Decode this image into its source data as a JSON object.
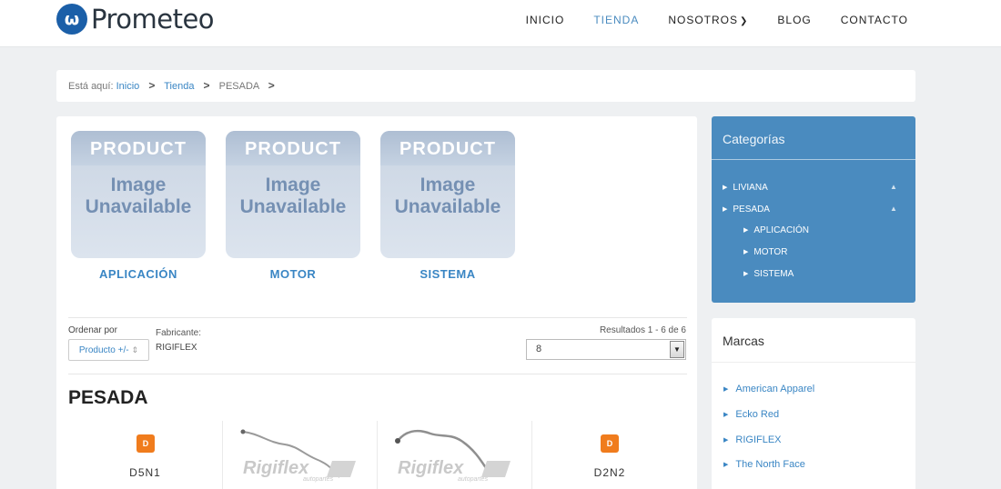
{
  "header": {
    "logo_text": "Prometeo",
    "nav": [
      {
        "label": "INICIO",
        "active": false
      },
      {
        "label": "TIENDA",
        "active": true
      },
      {
        "label": "NOSOTROS",
        "active": false
      },
      {
        "label": "BLOG",
        "active": false
      },
      {
        "label": "CONTACTO",
        "active": false
      }
    ]
  },
  "breadcrumb": {
    "prefix": "Está aquí:",
    "items": [
      "Inicio",
      "Tienda",
      "PESADA"
    ]
  },
  "categories": [
    {
      "image_top": "PRODUCT",
      "image_line1": "Image",
      "image_line2": "Unavailable",
      "label": "APLICACIÓN"
    },
    {
      "image_top": "PRODUCT",
      "image_line1": "Image",
      "image_line2": "Unavailable",
      "label": "MOTOR"
    },
    {
      "image_top": "PRODUCT",
      "image_line1": "Image",
      "image_line2": "Unavailable",
      "label": "SISTEMA"
    }
  ],
  "toolbar": {
    "sort_label": "Ordenar por",
    "sort_value": "Producto +/-",
    "manufacturer_label": "Fabricante:",
    "manufacturer_value": "RIGIFLEX",
    "results": "Resultados 1 - 6 de 6",
    "per_page": "8"
  },
  "section_title": "PESADA",
  "products": [
    {
      "name": "D5N1",
      "image": "brand-badge"
    },
    {
      "name": "",
      "image": "rigiflex-hose"
    },
    {
      "name": "",
      "image": "rigiflex-hose"
    },
    {
      "name": "D2N2",
      "image": "brand-badge"
    }
  ],
  "rigiflex_logo": {
    "main": "Rigiflex",
    "sub": "autopartes"
  },
  "sidebar": {
    "categories_title": "Categorías",
    "categories": [
      {
        "label": "LIVIANA",
        "level": 0
      },
      {
        "label": "PESADA",
        "level": 0
      },
      {
        "label": "APLICACIÓN",
        "level": 1
      },
      {
        "label": "MOTOR",
        "level": 1
      },
      {
        "label": "SISTEMA",
        "level": 1
      }
    ],
    "brands_title": "Marcas",
    "brands": [
      "American Apparel",
      "Ecko Red",
      "RIGIFLEX",
      "The North Face"
    ]
  },
  "colors": {
    "accent": "#4a8bbf",
    "link": "#3a86c4",
    "badge": "#f07c1d"
  }
}
